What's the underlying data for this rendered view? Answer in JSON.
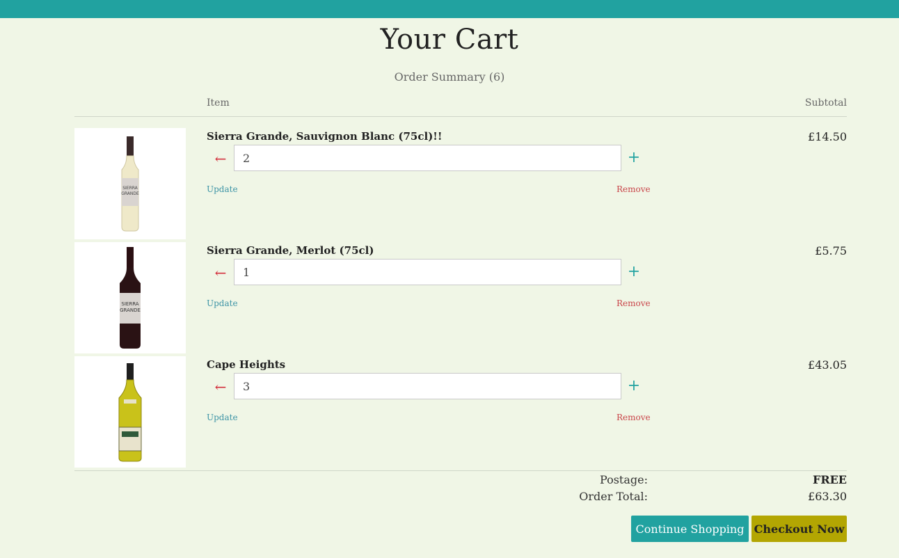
{
  "header": {
    "title": "Your Cart",
    "summary": "Order Summary (6)"
  },
  "columns": {
    "item": "Item",
    "subtotal": "Subtotal"
  },
  "items": [
    {
      "name": "Sierra Grande, Sauvignon Blanc (75cl)!!",
      "qty": "2",
      "subtotal": "£14.50",
      "label_line1": "SIERRA",
      "label_line2": "GRANDE",
      "wine_color": "#efe9c9",
      "update": "Update",
      "remove": "Remove"
    },
    {
      "name": "Sierra Grande, Merlot (75cl)",
      "qty": "1",
      "subtotal": "£5.75",
      "label_line1": "SIERRA",
      "label_line2": "GRANDE",
      "wine_color": "#2a1214",
      "update": "Update",
      "remove": "Remove"
    },
    {
      "name": "Cape Heights",
      "qty": "3",
      "subtotal": "£43.05",
      "label_line1": "",
      "label_line2": "",
      "wine_color": "#c9c21a",
      "update": "Update",
      "remove": "Remove"
    }
  ],
  "totals": {
    "postage_label": "Postage:",
    "postage_value": "FREE",
    "total_label": "Order Total:",
    "total_value": "£63.30"
  },
  "actions": {
    "continue": "Continue Shopping",
    "checkout": "Checkout Now"
  },
  "icons": {
    "decrement": "arrow-left-icon",
    "increment": "plus-icon"
  },
  "colors": {
    "topbar": "#21a2a0",
    "remove": "#c9454a",
    "update": "#3d94a6",
    "checkout": "#b3a602"
  }
}
